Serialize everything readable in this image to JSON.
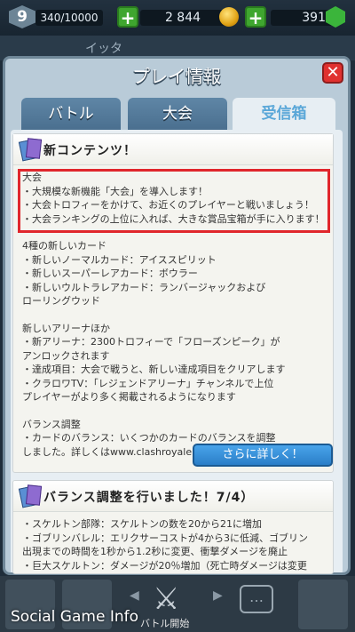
{
  "topbar": {
    "level": "9",
    "xp": "340/10000",
    "gold": "2 844",
    "gems": "391"
  },
  "background_text": "イッタ",
  "modal": {
    "title": "プレイ情報",
    "close_icon": "close-icon",
    "tabs": [
      {
        "label": "バトル"
      },
      {
        "label": "大会"
      },
      {
        "label": "受信箱"
      }
    ]
  },
  "card1": {
    "title": "新コンテンツ！",
    "lines": [
      "大会",
      "・大規模な新機能「大会」を導入します！",
      "・大会トロフィーをかけて、お近くのプレイヤーと戦いましょう！",
      "・大会ランキングの上位に入れば、大きな賞品宝箱が手に入ります！",
      "",
      "4種の新しいカード",
      "・新しいノーマルカード：アイススピリット",
      "・新しいスーパーレアカード：ボウラー",
      "・新しいウルトラレアカード：ランバージャックおよび",
      "ローリングウッド",
      "",
      "新しいアリーナほか",
      "・新アリーナ：2300トロフィーで「フローズンピーク」が",
      "アンロックされます",
      "・達成項目：大会で戦うと、新しい達成項目をクリアします",
      "・クラロワTV：「レジェンドアリーナ」チャンネルで上位",
      "プレイヤーがより多く掲載されるようになります",
      "",
      "バランス調整",
      "・カードのバランス：いくつかのカードのバランスを調整",
      "しました。詳しくはwww.clashroyale.comをご覧ください"
    ],
    "button": "さらに詳しく！"
  },
  "card2": {
    "title": "バランス調整を行いました！7/4）",
    "lines": [
      "・スケルトン部隊：スケルトンの数を20から21に増加",
      "・ゴブリンバレル：エリクサーコストが4から3に低減、ゴブリン",
      "出現までの時間を1秒から1.2秒に変更、衝撃ダメージを廃止",
      "・巨大スケルトン：ダメージが20％増加（死亡時ダメージは変更"
    ]
  },
  "bottombar": {
    "battle_label": "バトル開始"
  },
  "watermark": "Social Game Info",
  "colors": {
    "highlight_border": "#e0262c",
    "button_blue": "#2a7ec8",
    "close_red": "#e0312f",
    "tab_blue": "#4a6f8f"
  }
}
